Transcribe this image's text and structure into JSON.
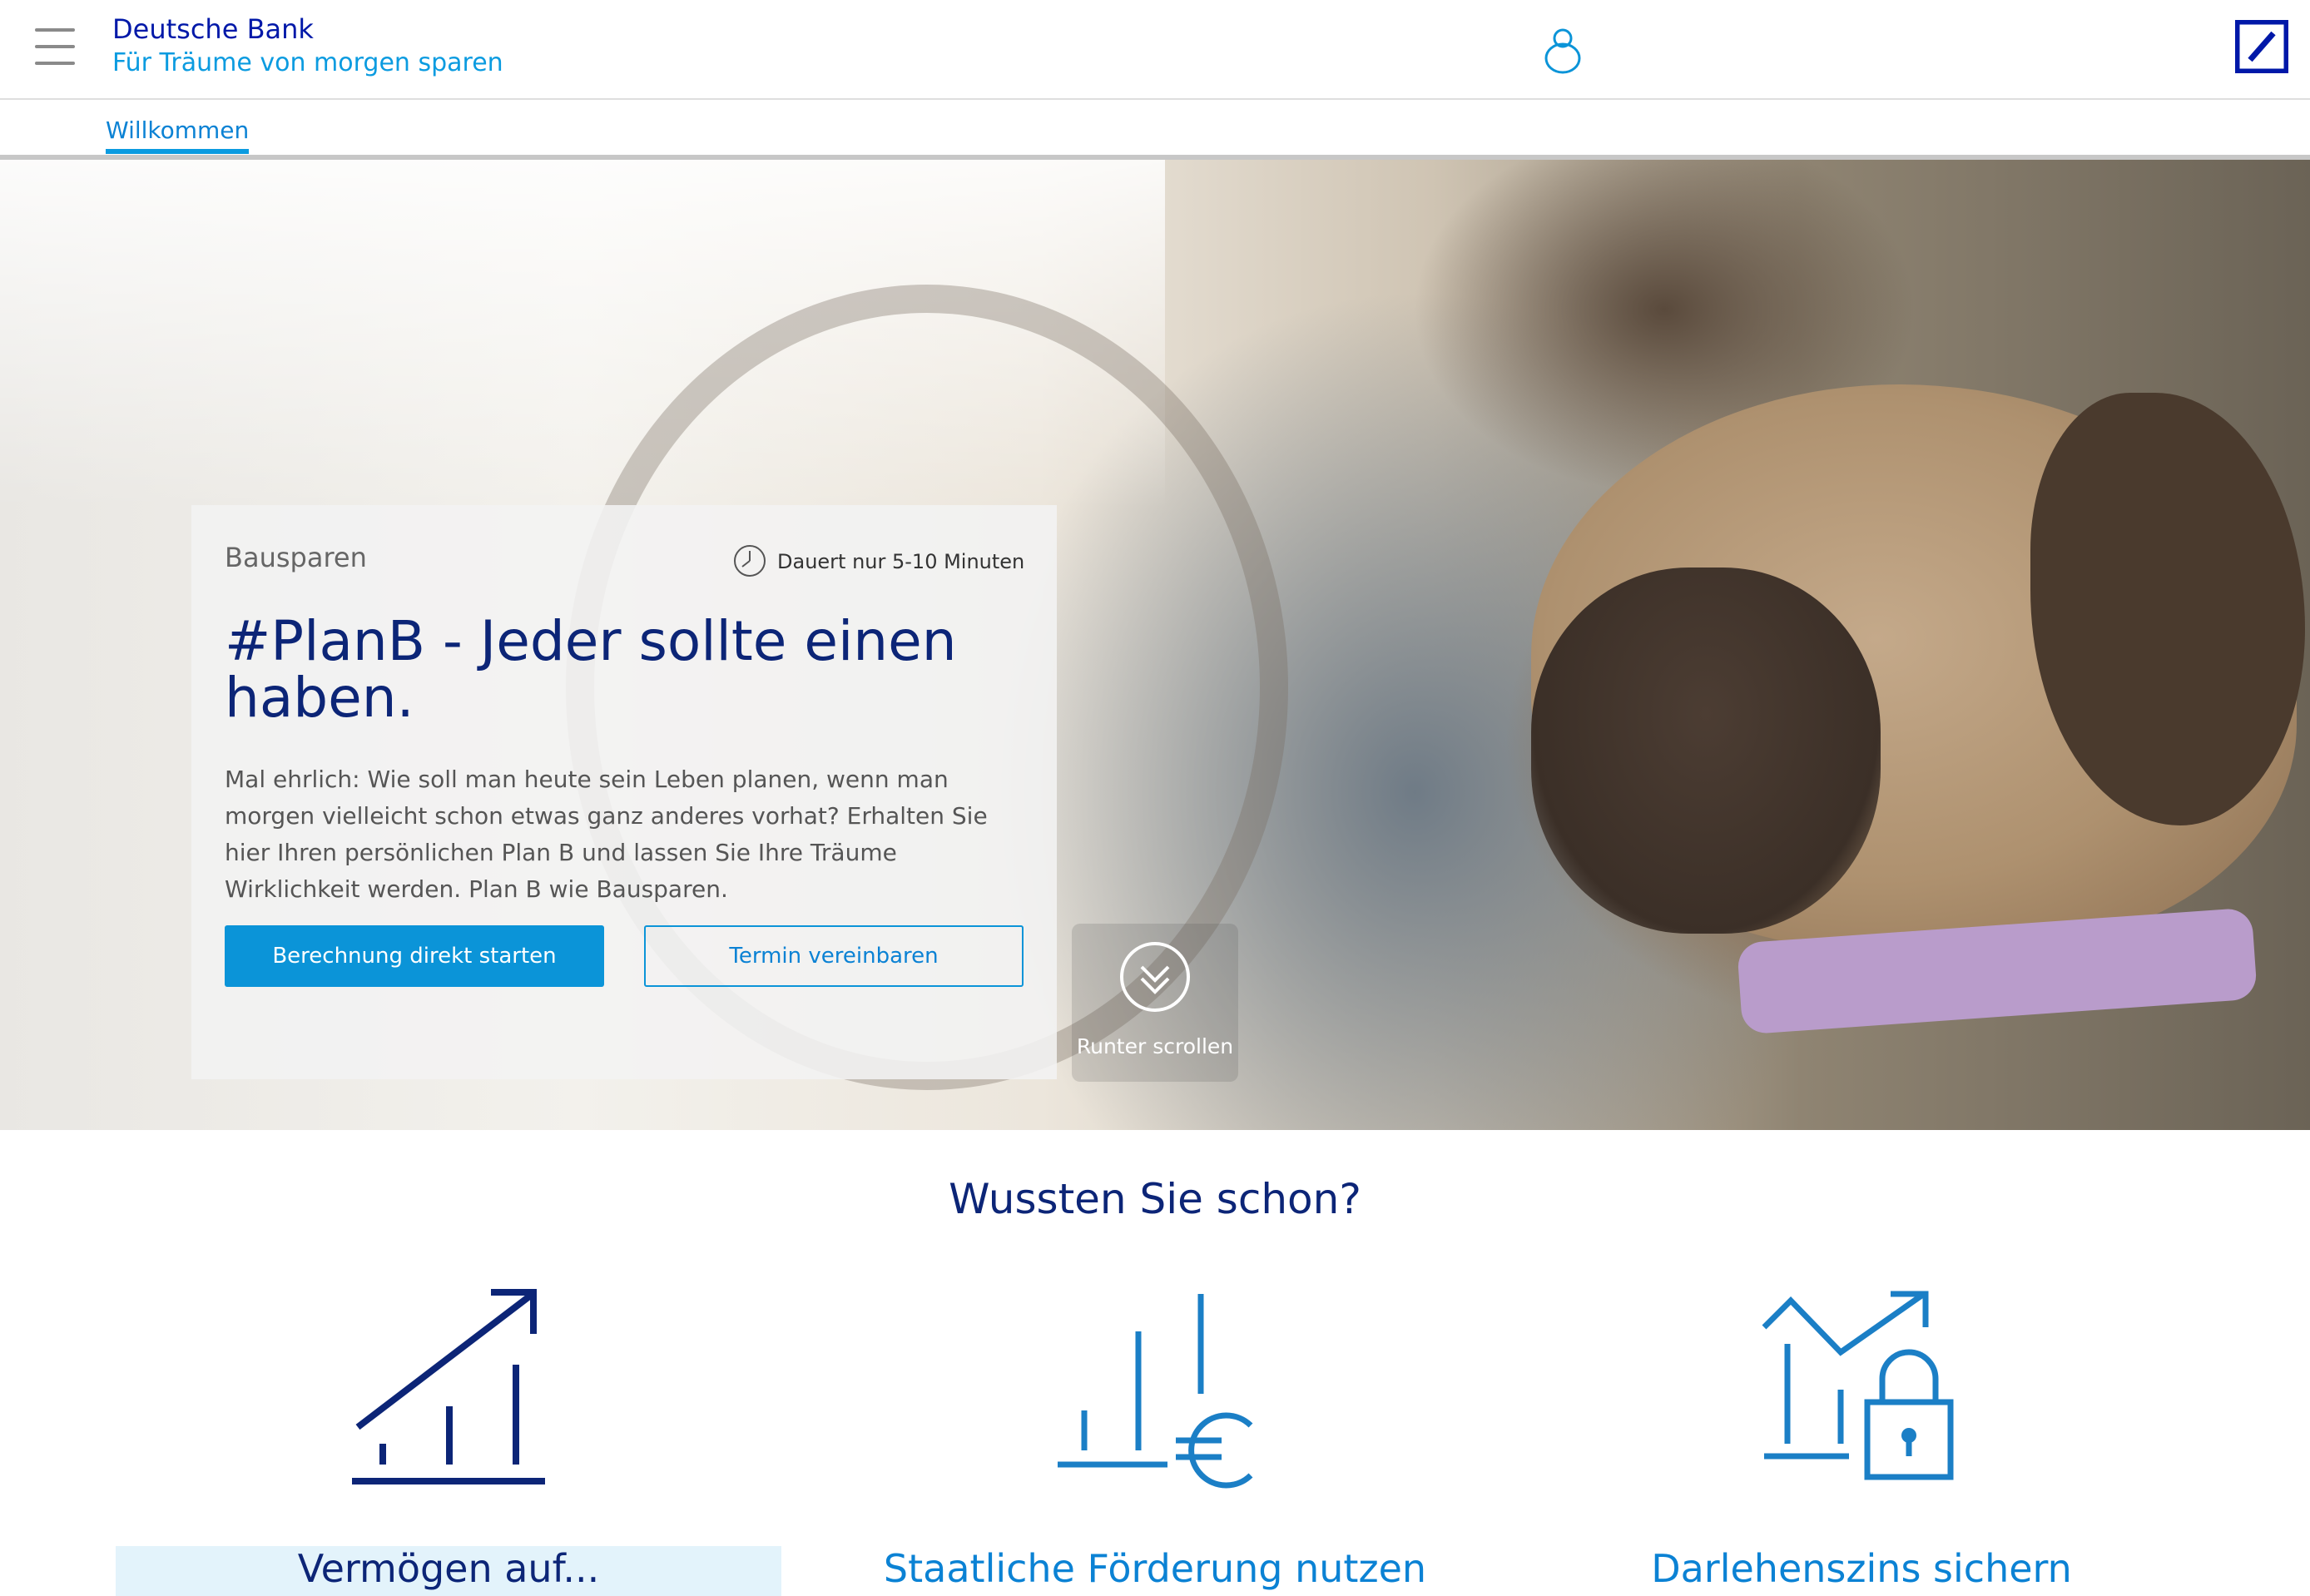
{
  "header": {
    "brand_name": "Deutsche Bank",
    "tagline": "Für Träume von morgen sparen",
    "menu_icon": "hamburger-menu-icon",
    "profile_icon": "user-icon",
    "logo": "deutsche-bank-logo"
  },
  "tabs": [
    {
      "label": "Willkommen",
      "active": true
    }
  ],
  "hero": {
    "category": "Bausparen",
    "duration": "Dauert nur 5-10 Minuten",
    "title": "#PlanB - Jeder sollte einen haben.",
    "text": "Mal ehrlich: Wie soll man heute sein Leben planen, wenn man morgen vielleicht schon etwas ganz anderes vorhat? Erhalten Sie hier Ihren persönlichen Plan B und lassen Sie Ihre Träume Wirklichkeit werden. Plan B wie Bausparen.",
    "primary_button": "Berechnung direkt starten",
    "secondary_button": "Termin vereinbaren",
    "scroll_label": "Runter scrollen"
  },
  "info": {
    "title": "Wussten Sie schon?",
    "features": [
      {
        "icon": "growth-chart-icon",
        "label": "Vermögen auf..."
      },
      {
        "icon": "euro-bar-chart-icon",
        "label": "Staatliche Förderung nutzen"
      },
      {
        "icon": "secured-interest-icon",
        "label": "Darlehenszins sichern"
      }
    ]
  },
  "colors": {
    "brand_blue": "#0018a8",
    "accent_blue": "#0b94d8",
    "navy": "#0c2577"
  }
}
